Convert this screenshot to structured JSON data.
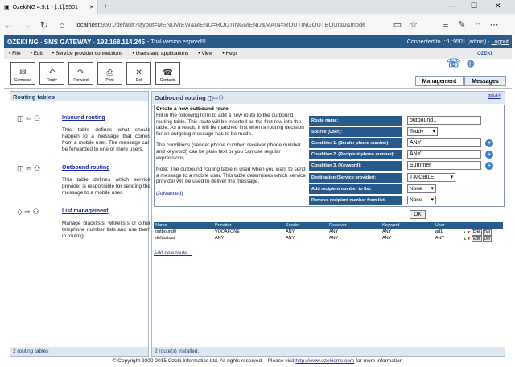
{
  "browser": {
    "tab_title": "OzekiNG 4.9.1 - [::1]:9501",
    "url_host": "localhost",
    "url_rest": ":9501/default?layout=MENUVIEW&MENU=ROUTINGMENU&MAIN=ROUTINGOUTBOUND&mode"
  },
  "header": {
    "title": "OZEKI NG - SMS GATEWAY - 192.168.114.245",
    "trial": "- Trial version expired!!!",
    "connected": "Connected to [::1]:9501 (admin) -",
    "logout": "Logout"
  },
  "menu": [
    "File",
    "Edit",
    "Service provider connections",
    "Users and applications",
    "View",
    "Help"
  ],
  "toolbar": [
    "Compose",
    "Reply",
    "Forward",
    "Print",
    "Del",
    "Contacts"
  ],
  "logo": "OZEKI",
  "subtabs": [
    "Management",
    "Messages"
  ],
  "left": {
    "title": "Routing tables",
    "footer": "2 routing tables",
    "entries": [
      {
        "link": "Inbound routing",
        "desc": "This table defines what should happen to a message that comes from a mobile user. The message can be forwarded to one or more users."
      },
      {
        "link": "Outbound routing",
        "desc": "This table defines which service provider is responsible for sending the message to a mobile user."
      },
      {
        "link": "List management",
        "desc": "Manage blacklists, whitelists or other telephone number lists and use them in routing."
      }
    ]
  },
  "right": {
    "title": "Outbound routing",
    "add": "Add",
    "footer": "2 route(s) installed.",
    "create_title": "Create a new outbound route",
    "intro1": "Fill in the following form to add a new route to the outbound routing table. This route will be inserted as the first row into the table. As a result, it will be matched first when a routing decision for an outgoing message has to be made.",
    "intro2": "The conditions (sender phone number, receiver phone number and keyword) can be plain text or you can use regular expressions.",
    "intro3": "Note: The outbound routing table is used when you want to send a message to a mobile user. This table determines which service provider will be used to deliver the message.",
    "advanced": "(Advanced)",
    "form": [
      {
        "label": "Route name:",
        "value": "outbound1"
      },
      {
        "label": "Source (User):",
        "value": "Teddy"
      },
      {
        "label": "Condition 1. (Sender phone number):",
        "value": "ANY"
      },
      {
        "label": "Condition 2. (Recipient phone number):",
        "value": "ANY"
      },
      {
        "label": "Condition 3. (Keyword):",
        "value": "Summer"
      },
      {
        "label": "Destination (Service provider):",
        "value": "T-MOBILE"
      },
      {
        "label": "Add recipient number to list:",
        "value": "None"
      },
      {
        "label": "Remove recipient number from list:",
        "value": "None"
      }
    ],
    "ok": "OK",
    "columns": [
      "Name",
      "Provider",
      "Sender",
      "Receiver",
      "Keyword",
      "User"
    ],
    "rows": [
      [
        "outbound0",
        "VODAFONE",
        "ANY",
        "ANY",
        "ANY",
        "ad1"
      ],
      [
        "defaultout",
        "ANY",
        "ANY",
        "ANY",
        "ANY",
        "ANY"
      ]
    ],
    "edit": "Edit",
    "del": "Del",
    "add_new": "Add new route..."
  },
  "footer": {
    "text": "© Copyright 2000-2015 Ozeki Informatics Ltd. All rights reserved. - Please visit",
    "link": "http://www.ozekisms.com",
    "tail": "for more information"
  },
  "colors": {
    "header": "#295a8c",
    "panel_title": "#dfe7f1",
    "link": "#1a2a9c"
  }
}
